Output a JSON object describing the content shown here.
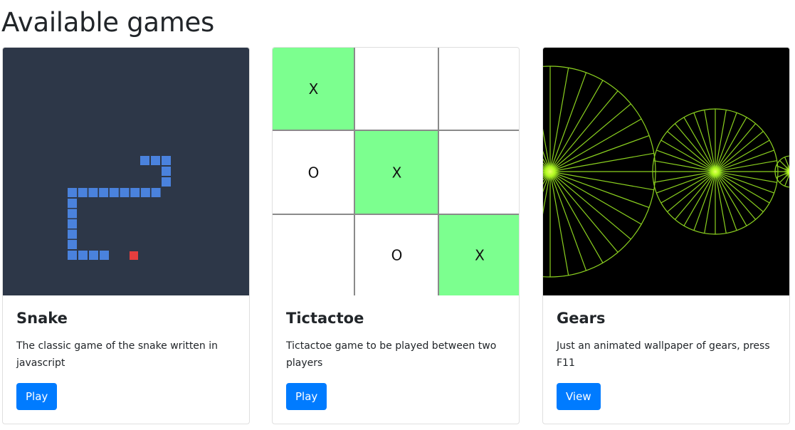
{
  "page": {
    "title": "Available games"
  },
  "games": [
    {
      "title": "Snake",
      "description": "The classic game of the snake written in javascript",
      "button_label": "Play",
      "preview": {
        "background": "#2d3748",
        "snake_color": "#4a82dd",
        "food_color": "#e53e3e"
      }
    },
    {
      "title": "Tictactoe",
      "description": "Tictactoe game to be played between two players",
      "button_label": "Play",
      "preview": {
        "highlight_color": "#7cff8f",
        "board": [
          [
            "X",
            "",
            ""
          ],
          [
            "O",
            "X",
            ""
          ],
          [
            "",
            "O",
            "X"
          ]
        ],
        "highlighted": [
          [
            true,
            false,
            false
          ],
          [
            false,
            true,
            false
          ],
          [
            false,
            false,
            true
          ]
        ]
      }
    },
    {
      "title": "Gears",
      "description": "Just an animated wallpaper of gears, press F11",
      "button_label": "View",
      "preview": {
        "background": "#000000",
        "line_color": "#8bd11f",
        "glow_color": "#c6ff33"
      }
    }
  ]
}
